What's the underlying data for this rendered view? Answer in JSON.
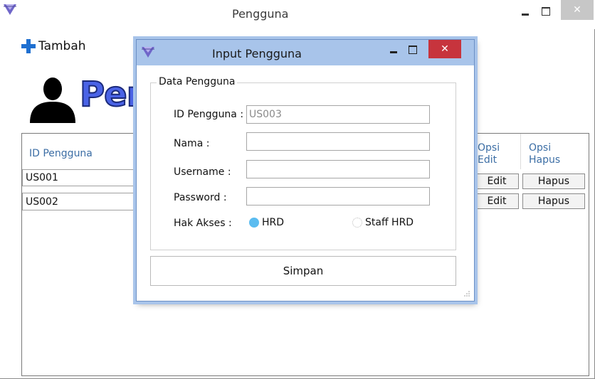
{
  "main_window": {
    "title": "Pengguna",
    "tambah_label": "Tambah",
    "banner_text": "Pen"
  },
  "grid": {
    "headers": {
      "id_pengguna": "ID Pengguna",
      "opsi_edit": "Opsi Edit",
      "opsi_hapus": "Opsi Hapus"
    },
    "rows": [
      {
        "id": "US001",
        "edit": "Edit",
        "hapus": "Hapus"
      },
      {
        "id": "US002",
        "edit": "Edit",
        "hapus": "Hapus"
      }
    ]
  },
  "dialog": {
    "title": "Input Pengguna",
    "group_title": "Data Pengguna",
    "id_label": "ID Pengguna :",
    "id_value": "US003",
    "nama_label": "Nama :",
    "nama_value": "",
    "username_label": "Username :",
    "username_value": "",
    "password_label": "Password :",
    "password_value": "",
    "hak_akses_label": "Hak Akses :",
    "hak_akses_options": [
      "HRD",
      "Staff HRD"
    ],
    "hak_akses_selected": "HRD",
    "simpan_label": "Simpan"
  },
  "colors": {
    "dialog_frame": "#a8c4ea",
    "close_button": "#c7343d",
    "plus_icon": "#1e6fd0",
    "banner": "#4a63e6",
    "radio_selected": "#5bbcf0"
  }
}
